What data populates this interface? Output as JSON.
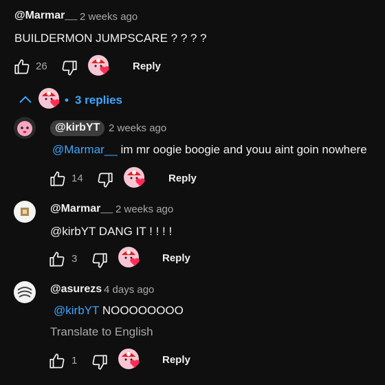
{
  "comment1": {
    "author": "@Marmar__",
    "time": "2 weeks ago",
    "text": "BUILDERMON JUMPSCARE ? ? ? ?",
    "likes": "26",
    "reply_label": "Reply"
  },
  "thread": {
    "toggle_icon": "chevron-up-icon",
    "separator": "•",
    "replies_label": "3 replies"
  },
  "replies": [
    {
      "author": "@kirbYT",
      "time": "2 weeks ago",
      "mention": "@Marmar__",
      "text": "im mr oogie boogie and youu aint goin nowhere",
      "likes": "14",
      "reply_label": "Reply"
    },
    {
      "author": "@Marmar__",
      "time": "2 weeks ago",
      "text": "@kirbYT  DANG IT ! ! ! !",
      "likes": "3",
      "reply_label": "Reply"
    },
    {
      "author": "@asurezs",
      "time": "4 days ago",
      "mention": "@kirbYT",
      "text": "NOOOOOOOO",
      "translate_label": "Translate to English",
      "likes": "1",
      "reply_label": "Reply"
    }
  ],
  "colors": {
    "background": "#0f0f0f",
    "text": "#f1f1f1",
    "muted": "#aaaaaa",
    "link": "#3ea6ff",
    "heart": "#ff2d55",
    "creator_chip": "#3d3d3d"
  }
}
